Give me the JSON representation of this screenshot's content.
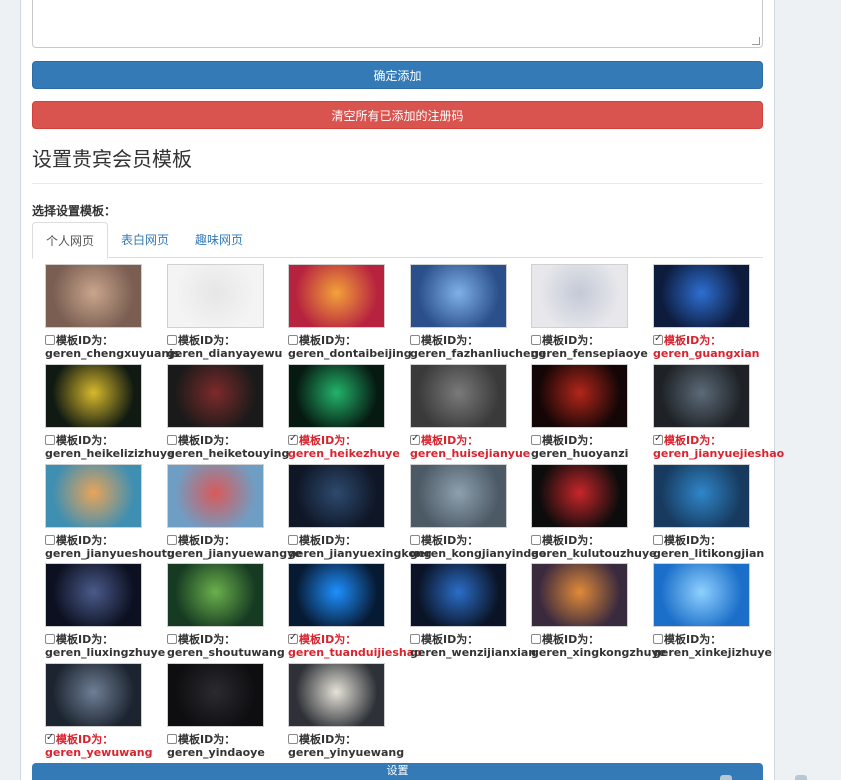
{
  "form": {
    "confirm_add": "确定添加",
    "clear_codes": "清空所有已添加的注册码"
  },
  "vip_section": {
    "title": "设置贵宾会员模板",
    "choose_label": "选择设置模板：",
    "tabs": [
      {
        "label": "个人网页",
        "active": true
      },
      {
        "label": "表白网页",
        "active": false
      },
      {
        "label": "趣味网页",
        "active": false
      }
    ],
    "id_prefix": "模板ID为：",
    "templates": [
      {
        "id": "geren_chengxuyuanjs",
        "checked": false,
        "icon": "monkey-sunglasses-thumbnail",
        "bg": "#7a5e52",
        "accent": "#c9a58c"
      },
      {
        "id": "geren_dianyayewu",
        "checked": false,
        "icon": "blank-white-thumbnail",
        "bg": "#f4f4f4",
        "accent": "#e6e6e6"
      },
      {
        "id": "geren_dontaibeijing",
        "checked": false,
        "icon": "anime-art-thumbnail",
        "bg": "#b7233f",
        "accent": "#f2a23a"
      },
      {
        "id": "geren_fazhanliucheng",
        "checked": false,
        "icon": "night-city-thumbnail",
        "bg": "#2a4f8a",
        "accent": "#7fb0e8"
      },
      {
        "id": "geren_fensepiaoye",
        "checked": false,
        "icon": "light-gradient-thumbnail",
        "bg": "#e8e8ec",
        "accent": "#c3c9d6"
      },
      {
        "id": "geren_guangxian",
        "checked": true,
        "icon": "blue-glow-thumbnail",
        "bg": "#0d1b3d",
        "accent": "#2e6fd1"
      },
      {
        "id": "geren_heikelizizhuye",
        "checked": false,
        "icon": "particle-burst-thumbnail",
        "bg": "#101a12",
        "accent": "#d8b92d"
      },
      {
        "id": "geren_heiketouying",
        "checked": false,
        "icon": "dark-spotlight-thumbnail",
        "bg": "#1a1a1a",
        "accent": "#7d2a2a"
      },
      {
        "id": "geren_heikezhuye",
        "checked": true,
        "icon": "matrix-rain-thumbnail",
        "bg": "#061a12",
        "accent": "#23b36a"
      },
      {
        "id": "geren_huisejianyue",
        "checked": true,
        "icon": "grey-minimal-thumbnail",
        "bg": "#3a3a3a",
        "accent": "#7a7a7a"
      },
      {
        "id": "geren_huoyanzi",
        "checked": false,
        "icon": "fire-text-thumbnail",
        "bg": "#140606",
        "accent": "#b3261a"
      },
      {
        "id": "geren_jianyuejieshao",
        "checked": true,
        "icon": "dark-bowl-thumbnail",
        "bg": "#1e2226",
        "accent": "#5c6a78"
      },
      {
        "id": "geren_jianyueshoutu",
        "checked": false,
        "icon": "sunset-sea-thumbnail",
        "bg": "#3f8fb2",
        "accent": "#e8a45a"
      },
      {
        "id": "geren_jianyuewangye",
        "checked": false,
        "icon": "pier-card-thumbnail",
        "bg": "#6f9ec4",
        "accent": "#d85a5a"
      },
      {
        "id": "geren_jianyuexingkong",
        "checked": false,
        "icon": "starry-sky-thumbnail",
        "bg": "#0f1626",
        "accent": "#2d4a6e"
      },
      {
        "id": "geren_kongjianyindao",
        "checked": false,
        "icon": "foggy-city-thumbnail",
        "bg": "#4c5a66",
        "accent": "#8ea0ae"
      },
      {
        "id": "geren_kulutouzhuye",
        "checked": false,
        "icon": "skull-thumbnail",
        "bg": "#0c0c0c",
        "accent": "#c8262a"
      },
      {
        "id": "geren_litikongjian",
        "checked": false,
        "icon": "blue-cubes-thumbnail",
        "bg": "#173a5e",
        "accent": "#2f86c9"
      },
      {
        "id": "geren_liuxingzhuye",
        "checked": false,
        "icon": "meteor-avatar-thumbnail",
        "bg": "#0c1020",
        "accent": "#4a5a8a"
      },
      {
        "id": "geren_shoutuwang",
        "checked": false,
        "icon": "green-banner-thumbnail",
        "bg": "#163a22",
        "accent": "#6ab04c"
      },
      {
        "id": "geren_tuanduijieshao",
        "checked": true,
        "icon": "blue-ring-thumbnail",
        "bg": "#071a33",
        "accent": "#1e90ff"
      },
      {
        "id": "geren_wenzijianxian",
        "checked": false,
        "icon": "blue-orbit-thumbnail",
        "bg": "#0a1426",
        "accent": "#2b6ec8"
      },
      {
        "id": "geren_xingkongzhuye",
        "checked": false,
        "icon": "nebula-thumbnail",
        "bg": "#3a2a3e",
        "accent": "#e08a3a"
      },
      {
        "id": "geren_xinkejizhuye",
        "checked": false,
        "icon": "tech-blue-thumbnail",
        "bg": "#1b6fc9",
        "accent": "#8fd0ff"
      },
      {
        "id": "geren_yewuwang",
        "checked": true,
        "icon": "dashboard-table-thumbnail",
        "bg": "#1c2430",
        "accent": "#6f7f95"
      },
      {
        "id": "geren_yindaoye",
        "checked": false,
        "icon": "dark-intro-thumbnail",
        "bg": "#0e0e10",
        "accent": "#2a2a30"
      },
      {
        "id": "geren_yinyuewang",
        "checked": false,
        "icon": "music-player-thumbnail",
        "bg": "#2e3238",
        "accent": "#e6e2d8"
      }
    ],
    "submit_label": "设置"
  },
  "colors": {
    "primary": "#337ab7",
    "danger": "#d9534f",
    "checked_text": "#d9232e"
  }
}
